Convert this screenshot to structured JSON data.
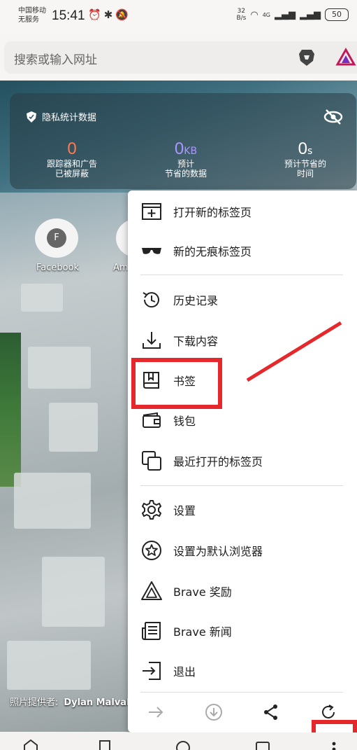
{
  "status_bar": {
    "carrier_line1": "中国移动",
    "carrier_line2": "无服务",
    "time": "15:41",
    "speed_value": "32",
    "speed_unit": "B/s",
    "network": "4G",
    "battery": "50"
  },
  "address_bar": {
    "placeholder": "搜索或输入网址"
  },
  "privacy_stats": {
    "title": "隐私统计数据",
    "trackers_value": "0",
    "trackers_label_1": "跟踪器和广告",
    "trackers_label_2": "已被屏蔽",
    "data_value": "0",
    "data_unit": "KB",
    "data_label_1": "预计",
    "data_label_2": "节省的数据",
    "time_value": "0",
    "time_unit": "s",
    "time_label_1": "预计节省的",
    "time_label_2": "时间"
  },
  "top_sites": [
    {
      "label": "Facebook",
      "initial": "F"
    },
    {
      "label": "Am"
    }
  ],
  "photo_credit": {
    "prefix": "照片提供者:",
    "name": "Dylan Malval"
  },
  "menu": {
    "items": [
      {
        "label": "打开新的标签页",
        "icon": "new-tab-icon"
      },
      {
        "label": "新的无痕标签页",
        "icon": "private-tab-icon"
      },
      {
        "label": "历史记录",
        "icon": "history-icon"
      },
      {
        "label": "下载内容",
        "icon": "download-icon"
      },
      {
        "label": "书签",
        "icon": "bookmark-icon"
      },
      {
        "label": "钱包",
        "icon": "wallet-icon"
      },
      {
        "label": "最近打开的标签页",
        "icon": "recent-tabs-icon"
      },
      {
        "label": "设置",
        "icon": "settings-icon"
      },
      {
        "label": "设置为默认浏览器",
        "icon": "default-browser-icon"
      },
      {
        "label": "Brave 奖励",
        "icon": "rewards-icon"
      },
      {
        "label": "Brave 新闻",
        "icon": "news-icon"
      },
      {
        "label": "退出",
        "icon": "exit-icon"
      }
    ],
    "bottom_actions": [
      "forward-icon",
      "download-page-icon",
      "share-icon",
      "reload-icon"
    ]
  },
  "colors": {
    "highlight": "#e5282b",
    "trackers_accent": "#ff7b4d",
    "data_accent": "#a997ff"
  }
}
